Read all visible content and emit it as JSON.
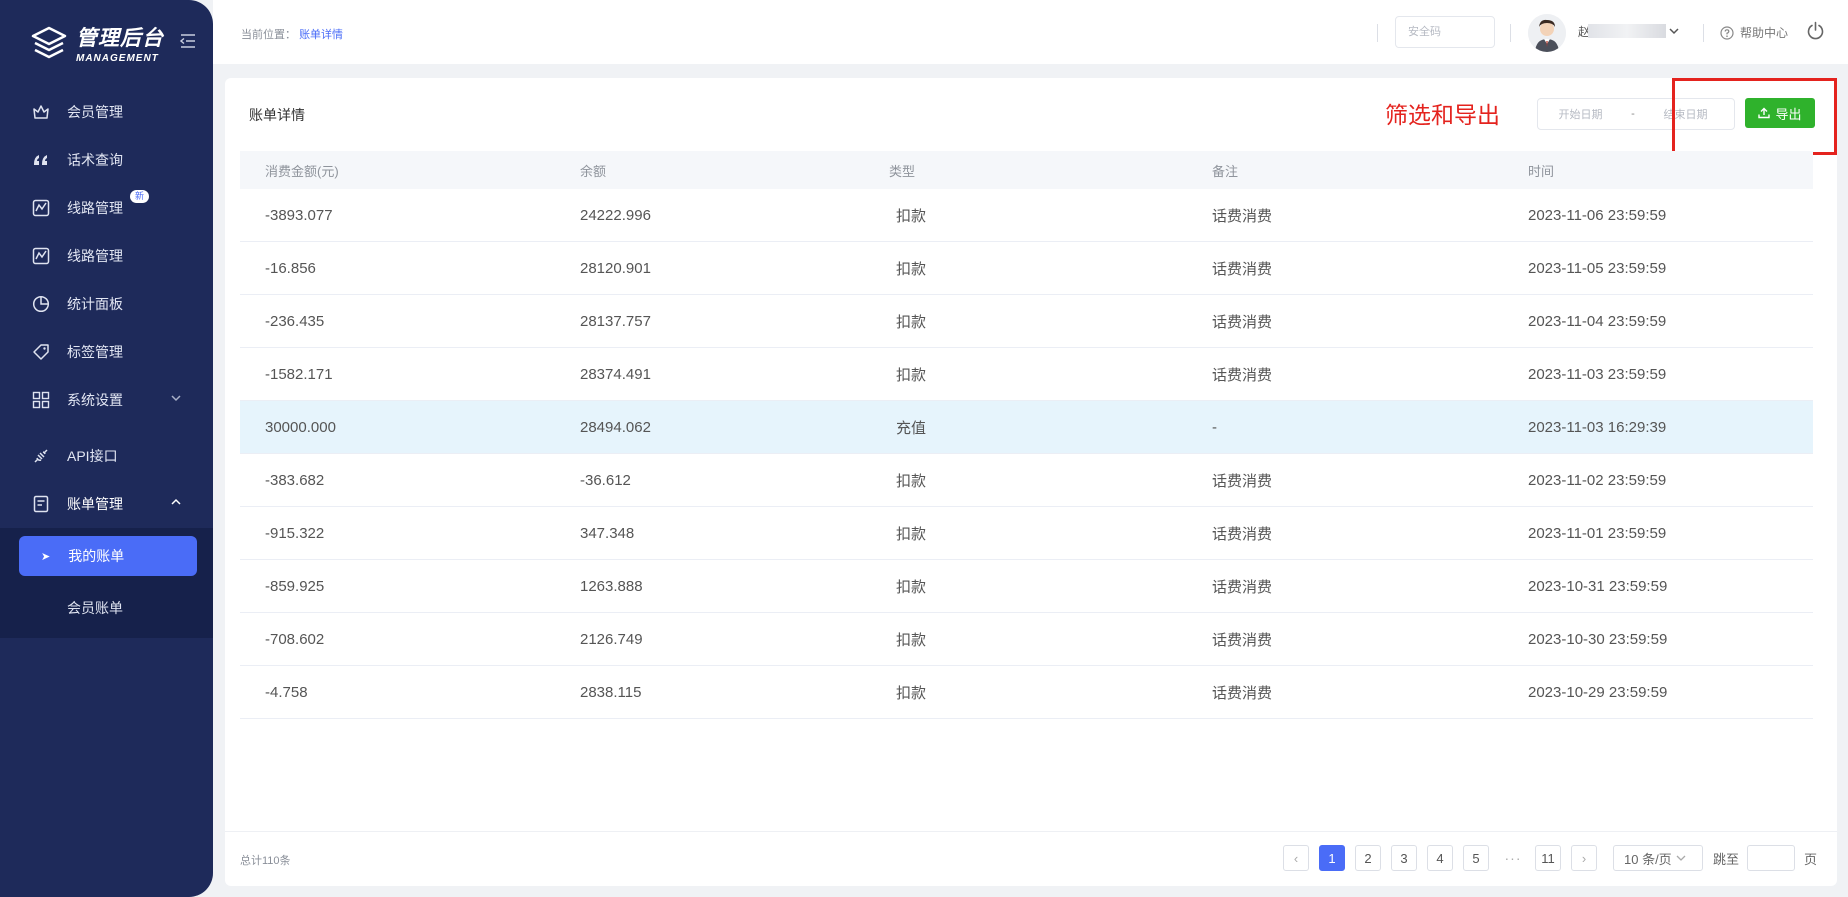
{
  "sidebar": {
    "logo_title": "管理后台",
    "logo_sub": "MANAGEMENT",
    "items": [
      {
        "label": "会员管理",
        "icon": "crown-icon"
      },
      {
        "label": "话术查询",
        "icon": "quote-icon"
      },
      {
        "label": "线路管理",
        "icon": "route-icon",
        "badge": "新"
      },
      {
        "label": "线路管理",
        "icon": "route-icon"
      },
      {
        "label": "统计面板",
        "icon": "pie-chart-icon"
      },
      {
        "label": "标签管理",
        "icon": "tag-icon"
      },
      {
        "label": "系统设置",
        "icon": "grid-icon"
      },
      {
        "label": "API接口",
        "icon": "plug-icon"
      },
      {
        "label": "账单管理",
        "icon": "bill-icon"
      }
    ],
    "sub_items": [
      {
        "label": "我的账单",
        "active": true
      },
      {
        "label": "会员账单",
        "active": false
      }
    ]
  },
  "header": {
    "crumb_prefix": "当前位置：",
    "crumb_current": "账单详情",
    "security_placeholder": "安全码",
    "username": "赵",
    "help": "帮助中心"
  },
  "card": {
    "title": "账单详情",
    "annotation": "筛选和导出",
    "start_date": "开始日期",
    "range_sep": "-",
    "end_date": "结束日期",
    "export": "导出"
  },
  "table": {
    "columns": [
      "消费金额(元)",
      "余额",
      "类型",
      "备注",
      "时间"
    ],
    "rows": [
      [
        "-3893.077",
        "24222.996",
        "扣款",
        "话费消费",
        "2023-11-06 23:59:59"
      ],
      [
        "-16.856",
        "28120.901",
        "扣款",
        "话费消费",
        "2023-11-05 23:59:59"
      ],
      [
        "-236.435",
        "28137.757",
        "扣款",
        "话费消费",
        "2023-11-04 23:59:59"
      ],
      [
        "-1582.171",
        "28374.491",
        "扣款",
        "话费消费",
        "2023-11-03 23:59:59"
      ],
      [
        "30000.000",
        "28494.062",
        "充值",
        "-",
        "2023-11-03 16:29:39"
      ],
      [
        "-383.682",
        "-36.612",
        "扣款",
        "话费消费",
        "2023-11-02 23:59:59"
      ],
      [
        "-915.322",
        "347.348",
        "扣款",
        "话费消费",
        "2023-11-01 23:59:59"
      ],
      [
        "-859.925",
        "1263.888",
        "扣款",
        "话费消费",
        "2023-10-31 23:59:59"
      ],
      [
        "-708.602",
        "2126.749",
        "扣款",
        "话费消费",
        "2023-10-30 23:59:59"
      ],
      [
        "-4.758",
        "2838.115",
        "扣款",
        "话费消费",
        "2023-10-29 23:59:59"
      ]
    ],
    "highlight_row": 4
  },
  "footer": {
    "total": "总计110条",
    "pages": [
      "1",
      "2",
      "3",
      "4",
      "5"
    ],
    "ellipsis": "···",
    "last_page": "11",
    "current_page": 1,
    "page_size": "10 条/页",
    "jump_label": "跳至",
    "page_unit": "页"
  },
  "colors": {
    "sidebar_bg": "#1e2a5a",
    "accent": "#4a6cf7",
    "export_green": "#2fb22c",
    "annotation_red": "#e4231e"
  }
}
